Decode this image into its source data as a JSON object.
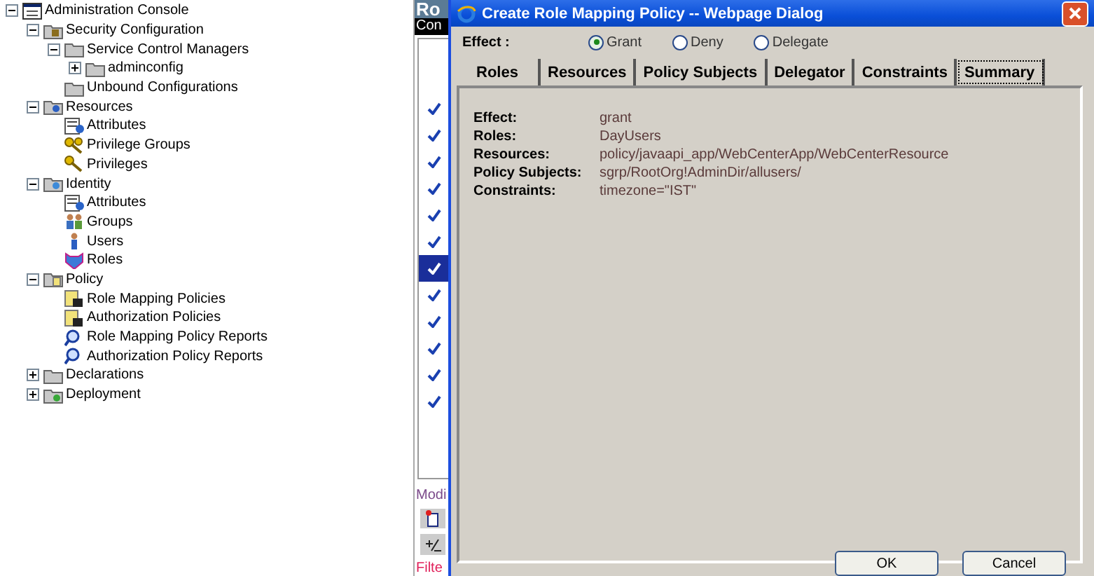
{
  "tree": [
    {
      "label": "Administration Console",
      "kind": "console",
      "expanded": true,
      "children": [
        {
          "label": "Security Configuration",
          "kind": "lock-folder",
          "expanded": true,
          "children": [
            {
              "label": "Service Control Managers",
              "kind": "folder",
              "expanded": true,
              "children": [
                {
                  "label": "adminconfig",
                  "kind": "folder",
                  "expanded": false
                }
              ]
            },
            {
              "label": "Unbound Configurations",
              "kind": "folder"
            }
          ]
        },
        {
          "label": "Resources",
          "kind": "resources",
          "expanded": true,
          "children": [
            {
              "label": "Attributes",
              "kind": "attributes"
            },
            {
              "label": "Privilege Groups",
              "kind": "keys"
            },
            {
              "label": "Privileges",
              "kind": "key"
            }
          ]
        },
        {
          "label": "Identity",
          "kind": "identity",
          "expanded": true,
          "children": [
            {
              "label": "Attributes",
              "kind": "attributes"
            },
            {
              "label": "Groups",
              "kind": "group"
            },
            {
              "label": "Users",
              "kind": "user"
            },
            {
              "label": "Roles",
              "kind": "roles"
            }
          ]
        },
        {
          "label": "Policy",
          "kind": "policy",
          "expanded": true,
          "children": [
            {
              "label": "Role Mapping Policies",
              "kind": "policy-doc"
            },
            {
              "label": "Authorization Policies",
              "kind": "policy-doc"
            },
            {
              "label": "Role Mapping Policy Reports",
              "kind": "report"
            },
            {
              "label": "Authorization Policy Reports",
              "kind": "report"
            }
          ]
        },
        {
          "label": "Declarations",
          "kind": "folder",
          "expanded": false
        },
        {
          "label": "Deployment",
          "kind": "deployment",
          "expanded": false
        }
      ]
    }
  ],
  "back_window": {
    "title": "Ro",
    "header": "Con",
    "rows": [
      {
        "selected": false
      },
      {
        "selected": false
      },
      {
        "selected": false
      },
      {
        "selected": false
      },
      {
        "selected": false
      },
      {
        "selected": false
      },
      {
        "selected": true
      },
      {
        "selected": false
      },
      {
        "selected": false
      },
      {
        "selected": false
      },
      {
        "selected": false
      },
      {
        "selected": false
      }
    ],
    "section": "Modi",
    "filter": "Filte"
  },
  "dialog": {
    "title": "Create Role Mapping Policy -- Webpage Dialog",
    "effect_label": "Effect :",
    "effect_options": [
      {
        "label": "Grant",
        "selected": true
      },
      {
        "label": "Deny",
        "selected": false
      },
      {
        "label": "Delegate",
        "selected": false
      }
    ],
    "tabs": [
      {
        "label": "Roles",
        "selected": false
      },
      {
        "label": "Resources",
        "selected": false
      },
      {
        "label": "Policy Subjects",
        "selected": false
      },
      {
        "label": "Delegator",
        "selected": false
      },
      {
        "label": "Constraints",
        "selected": false
      },
      {
        "label": "Summary",
        "selected": true
      }
    ],
    "summary": [
      {
        "label": "Effect:",
        "value": "grant"
      },
      {
        "label": "Roles:",
        "value": "DayUsers"
      },
      {
        "label": "Resources:",
        "value": "policy/javaapi_app/WebCenterApp/WebCenterResource"
      },
      {
        "label": "Policy Subjects:",
        "value": "sgrp/RootOrg!AdminDir/allusers/"
      },
      {
        "label": "Constraints:",
        "value": "timezone=\"IST\""
      }
    ],
    "buttons": [
      "OK",
      "Cancel"
    ]
  }
}
